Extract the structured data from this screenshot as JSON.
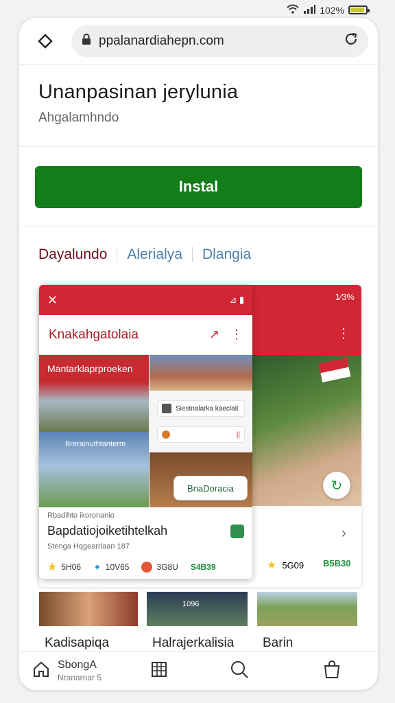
{
  "status": {
    "battery_text": "102%",
    "battery_level": 0.9
  },
  "browser": {
    "url": "ppalanardiahepn.com",
    "home_icon": "diamond-icon",
    "lock_icon": "lock-icon",
    "reload_icon": "reload-icon"
  },
  "app": {
    "title": "Unanpasinan jerylunia",
    "subtitle": "Ahgalamhndo",
    "install_label": "Instal"
  },
  "tabs": [
    {
      "label": "Dayalundo"
    },
    {
      "label": "Alerialya"
    },
    {
      "label": "Dlangia"
    }
  ],
  "screenshot_front": {
    "title": "Knakahgatolaia",
    "tile1_label": "Mantarklaprproeken",
    "tile3_row1": "Siestnalarka kaeclait",
    "tile4_label": "Brerainuthtanterm",
    "button_label": "BnaDoracia",
    "caption_small": "Rbadihto ikoronanio",
    "caption_title": "Bapdatiojoiketihtelkah",
    "caption_meta": "Stenga Hqgearrlaan 187",
    "stats": [
      {
        "icon": "star-icon",
        "value": "5H06"
      },
      {
        "icon": "bird-icon",
        "value": "10V65"
      },
      {
        "icon": "emoji-icon",
        "value": "3G8U"
      }
    ],
    "stat_green": "S4B39"
  },
  "screenshot_back": {
    "status_text": "1⁄3%",
    "stat_star": "5G09",
    "stat_green": "B5B30"
  },
  "thumbs": [
    {
      "label": "Kadisapiqa"
    },
    {
      "label": "Halrajerkalisia",
      "badge": "1096"
    },
    {
      "label": "Barin"
    }
  ],
  "bottom_nav": {
    "home_label": "SbongA",
    "home_sublabel": "Nranarnar 5",
    "items": [
      "home-icon",
      "grid-icon",
      "search-icon",
      "bag-icon"
    ]
  },
  "colors": {
    "install": "#137d19",
    "brand_red": "#d22634",
    "tab_active": "#6d1020",
    "tab_inactive": "#4a7fa6"
  }
}
